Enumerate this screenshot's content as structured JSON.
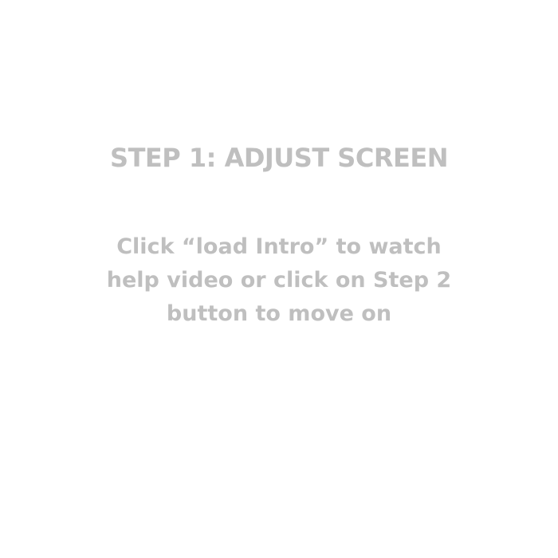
{
  "screen": {
    "title": "STEP 1: ADJUST SCREEN",
    "instructions": [
      "Click “load Intro” to watch",
      "help video or click on Step 2",
      "button to move on"
    ]
  },
  "colors": {
    "background": "#ffffff",
    "text": "#bfbfbf"
  }
}
